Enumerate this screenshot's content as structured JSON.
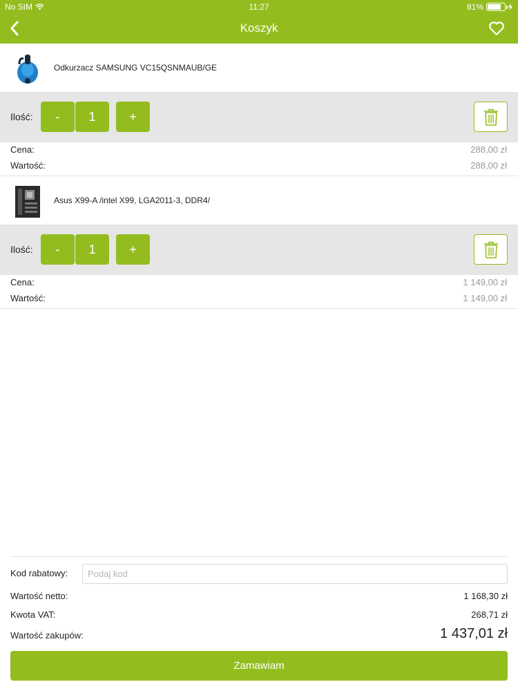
{
  "status_bar": {
    "carrier": "No SIM",
    "time": "11:27",
    "battery": "81%",
    "battery_level": 0.81
  },
  "header": {
    "title": "Koszyk",
    "back_icon": "chevron-left-icon",
    "favorite_icon": "heart-icon"
  },
  "cart": {
    "items": [
      {
        "name": "Odkurzacz SAMSUNG VC15QSNMAUB/GE",
        "thumbnail_icon": "vacuum-cleaner-icon",
        "quantity_label": "Ilość:",
        "minus_label": "-",
        "quantity": "1",
        "plus_label": "+",
        "delete_icon": "trash-icon",
        "price_label": "Cena:",
        "price": "288,00 zł",
        "value_label": "Wartość:",
        "value": "288,00 zł"
      },
      {
        "name": "Asus X99-A /intel X99, LGA2011-3, DDR4/",
        "thumbnail_icon": "motherboard-icon",
        "quantity_label": "Ilość:",
        "minus_label": "-",
        "quantity": "1",
        "plus_label": "+",
        "delete_icon": "trash-icon",
        "price_label": "Cena:",
        "price": "1 149,00 zł",
        "value_label": "Wartość:",
        "value": "1 149,00 zł"
      }
    ]
  },
  "summary": {
    "promo_label": "Kod rabatowy:",
    "promo_value": "",
    "promo_placeholder": "Podaj kod",
    "net_label": "Wartość netto:",
    "net_value": "1 168,30 zł",
    "vat_label": "Kwota VAT:",
    "vat_value": "268,71 zł",
    "total_label": "Wartość zakupów:",
    "total_value": "1 437,01 zł"
  },
  "order_button": "Zamawiam",
  "colors": {
    "accent": "#93bd1f",
    "row_background": "#e6e6e6",
    "muted_text": "#9a9a9a"
  }
}
